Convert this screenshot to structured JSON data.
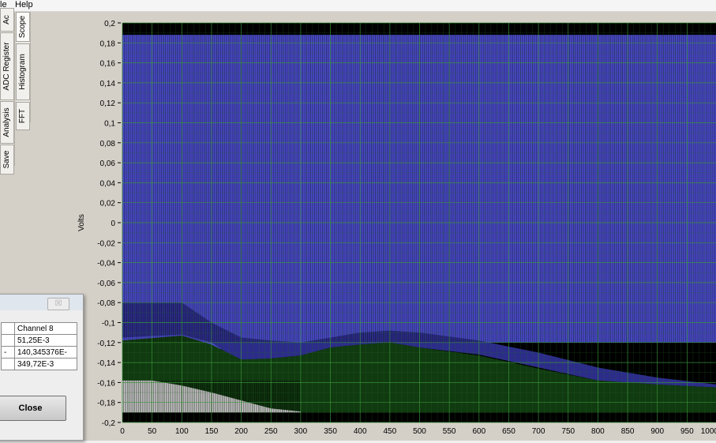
{
  "menu": {
    "file_partial": "le",
    "help": "Help"
  },
  "left_tabs": [
    {
      "label": "Ac"
    },
    {
      "label": "ADC Register"
    },
    {
      "label": "Analysis"
    },
    {
      "label": "Save"
    }
  ],
  "graph_tabs": [
    {
      "label": "Scope"
    },
    {
      "label": "Histogram"
    },
    {
      "label": "FFT"
    }
  ],
  "chart_data": {
    "type": "line",
    "title": "",
    "xlabel": "",
    "ylabel": "Volts",
    "xlim": [
      0,
      1000
    ],
    "ylim": [
      -0.2,
      0.2
    ],
    "x_ticks": [
      "0",
      "50",
      "100",
      "150",
      "200",
      "250",
      "300",
      "350",
      "400",
      "450",
      "500",
      "550",
      "600",
      "650",
      "700",
      "750",
      "800",
      "850",
      "900",
      "950",
      "1000"
    ],
    "y_ticks": [
      "0,2",
      "0,18",
      "0,16",
      "0,14",
      "0,12",
      "0,1",
      "0,08",
      "0,06",
      "0,04",
      "0,02",
      "0",
      "-0,02",
      "-0,04",
      "-0,06",
      "-0,08",
      "-0,1",
      "-0,12",
      "-0,14",
      "-0,16",
      "-0,18",
      "-0,2"
    ],
    "grid": true,
    "background": "#000000",
    "series": [
      {
        "color": "#4a4ac8",
        "envelope_x": [
          0,
          100,
          200,
          300,
          400,
          500,
          600,
          700,
          800,
          900,
          1000
        ],
        "upper": [
          0.188,
          0.188,
          0.188,
          0.188,
          0.188,
          0.188,
          0.188,
          0.188,
          0.188,
          0.188,
          0.188
        ],
        "lower": [
          -0.12,
          -0.12,
          -0.13,
          -0.12,
          -0.12,
          -0.12,
          -0.12,
          -0.12,
          -0.12,
          -0.12,
          -0.12
        ]
      },
      {
        "color": "#2c2c8a",
        "envelope_x": [
          0,
          100,
          150,
          200,
          250,
          300,
          350,
          400,
          450,
          500,
          600,
          700,
          800,
          900,
          1000
        ],
        "upper": [
          -0.08,
          -0.08,
          -0.1,
          -0.115,
          -0.118,
          -0.12,
          -0.115,
          -0.11,
          -0.108,
          -0.11,
          -0.118,
          -0.13,
          -0.145,
          -0.155,
          -0.162
        ],
        "lower": [
          -0.115,
          -0.112,
          -0.12,
          -0.14,
          -0.136,
          -0.133,
          -0.125,
          -0.122,
          -0.12,
          -0.125,
          -0.132,
          -0.145,
          -0.158,
          -0.162,
          -0.165
        ]
      },
      {
        "color": "#103a10",
        "envelope_x": [
          0,
          100,
          150,
          200,
          250,
          300,
          350,
          400,
          450,
          500,
          600,
          700,
          800,
          900,
          1000
        ],
        "upper": [
          -0.118,
          -0.113,
          -0.122,
          -0.137,
          -0.136,
          -0.133,
          -0.125,
          -0.122,
          -0.12,
          -0.125,
          -0.133,
          -0.146,
          -0.158,
          -0.162,
          -0.165
        ],
        "lower": [
          -0.19,
          -0.19,
          -0.19,
          -0.19,
          -0.19,
          -0.19,
          -0.19,
          -0.19,
          -0.19,
          -0.19,
          -0.19,
          -0.19,
          -0.19,
          -0.19,
          -0.19
        ]
      },
      {
        "color": "#e0e0e0",
        "envelope_x": [
          0,
          50,
          100,
          150,
          200,
          250,
          300
        ],
        "upper": [
          -0.158,
          -0.158,
          -0.163,
          -0.17,
          -0.178,
          -0.186,
          -0.189
        ],
        "lower": [
          -0.19,
          -0.19,
          -0.19,
          -0.19,
          -0.19,
          -0.19,
          -0.19
        ]
      }
    ]
  },
  "dialog": {
    "close_glyph": "☒",
    "rows": [
      {
        "label": "",
        "value": "Channel 8"
      },
      {
        "label": "",
        "value": "51,25E-3"
      },
      {
        "label": "-",
        "value": "140,345376E-"
      },
      {
        "label": "",
        "value": "349,72E-3"
      }
    ],
    "close_label": "Close"
  }
}
